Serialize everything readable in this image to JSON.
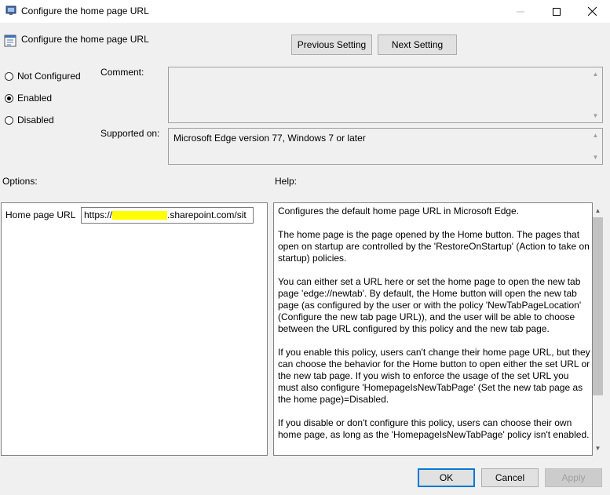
{
  "window": {
    "title": "Configure the home page URL"
  },
  "header": {
    "title": "Configure the home page URL",
    "prev_label": "Previous Setting",
    "next_label": "Next Setting"
  },
  "state": {
    "options": [
      {
        "label": "Not Configured",
        "selected": false
      },
      {
        "label": "Enabled",
        "selected": true
      },
      {
        "label": "Disabled",
        "selected": false
      }
    ]
  },
  "comment": {
    "label": "Comment:",
    "value": ""
  },
  "supported": {
    "label": "Supported on:",
    "value": "Microsoft Edge version 77, Windows 7 or later"
  },
  "options_section": {
    "label": "Options:",
    "home_label": "Home page URL",
    "url_prefix": "https://",
    "url_suffix": ".sharepoint.com/sit"
  },
  "help": {
    "label": "Help:",
    "paragraphs": [
      "Configures the default home page URL in Microsoft Edge.",
      "The home page is the page opened by the Home button. The pages that open on startup are controlled by the 'RestoreOnStartup' (Action to take on startup) policies.",
      "You can either set a URL here or set the home page to open the new tab page 'edge://newtab'. By default, the Home button will open the new tab page (as configured by the user or with the policy 'NewTabPageLocation' (Configure the new tab page URL)), and the user will be able to choose between the URL configured by this policy and the new tab page.",
      "If you enable this policy, users can't change their home page URL, but they can choose the behavior for the Home button to open either the set URL or the new tab page. If you wish to enforce the usage of the set URL you must also configure 'HomepageIsNewTabPage' (Set the new tab page as the home page)=Disabled.",
      "If you disable or don't configure this policy, users can choose their own home page, as long as the 'HomepageIsNewTabPage' policy isn't enabled."
    ]
  },
  "footer": {
    "ok": "OK",
    "cancel": "Cancel",
    "apply": "Apply"
  },
  "colors": {
    "accent": "#0078d7",
    "redaction": "#ffff00"
  }
}
